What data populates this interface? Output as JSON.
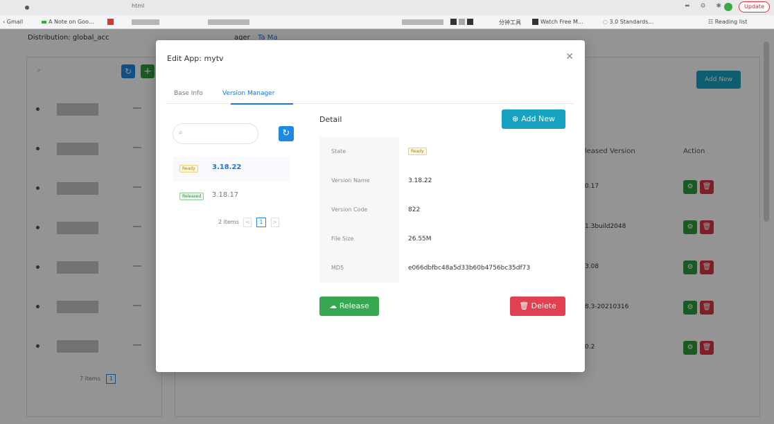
{
  "browser": {
    "tab_title": "html",
    "update_label": "Update",
    "bookmarks": {
      "gmail": "Gmail",
      "anote": "A Note on Goo...",
      "tool": "分钟工具",
      "watch": "Watch Free M...",
      "standards": "3.0 Standards...",
      "reading_list": "Reading list"
    }
  },
  "background": {
    "distribution_label": "Distribution: global_acc",
    "manager_label": "ager",
    "tab_label": "Ta  Ma",
    "add_new_label": "Add New",
    "columns": {
      "released_version": "leased Version",
      "action": "Action"
    },
    "rows": [
      "0.17",
      "1.3build2048",
      "3.08",
      "8.3-20210316",
      "0.2"
    ],
    "pager_items": "7 items",
    "pager_page": "1"
  },
  "modal": {
    "title": "Edit App: mytv",
    "tabs": [
      "Base Info",
      "Version Manager"
    ],
    "search_placeholder": "",
    "versions": [
      {
        "badge": "Ready",
        "version": "3.18.22"
      },
      {
        "badge": "Released",
        "version": "3.18.17"
      }
    ],
    "pager": {
      "items": "2 items",
      "prev": "<",
      "page": "1",
      "next": ">"
    },
    "detail": {
      "heading": "Detail",
      "add_new_label": "Add New",
      "rows": [
        {
          "label": "State",
          "value": "Ready"
        },
        {
          "label": "Version Name",
          "value": "3.18.22"
        },
        {
          "label": "Version Code",
          "value": "822"
        },
        {
          "label": "File Size",
          "value": "26.55M"
        },
        {
          "label": "MD5",
          "value": "e066dbfbc48a5d33b60b4756bc35df73"
        }
      ]
    },
    "release_label": "Release",
    "delete_label": "Delete"
  },
  "colors": {
    "primary": "#1e88e5",
    "teal": "#17a2c2",
    "green": "#36a852",
    "red": "#e0404f"
  }
}
